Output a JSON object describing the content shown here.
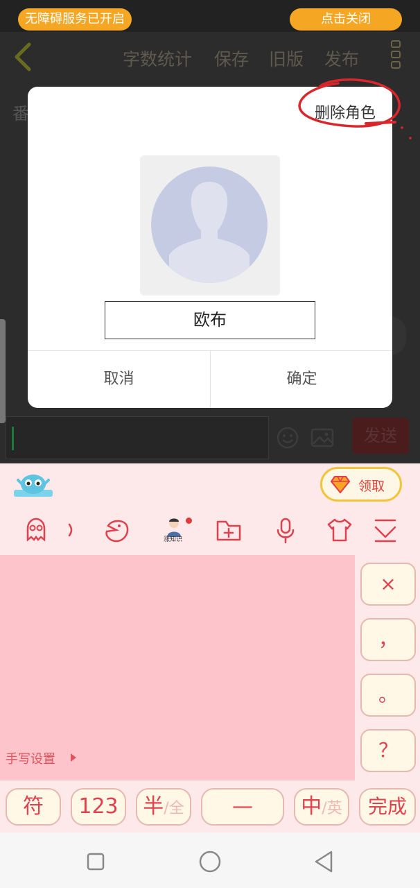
{
  "status_bar": {
    "accessibility_notice": "无障碍服务已开启",
    "close_label": "点击关闭"
  },
  "header": {
    "items": [
      "字数统计",
      "保存",
      "旧版",
      "发布"
    ]
  },
  "background": {
    "partial_text": "番",
    "send_label": "发送"
  },
  "dialog": {
    "delete_role_label": "删除角色",
    "name_value": "欧布",
    "cancel_label": "取消",
    "confirm_label": "确定"
  },
  "keyboard": {
    "reward_label": "领取",
    "tool_caption": "涨知识",
    "handwriting_settings": "手写设置",
    "side_keys": [
      "×",
      "，",
      "。",
      "？"
    ],
    "bottom_keys": {
      "symbols": "符",
      "numbers": "123",
      "half": "半",
      "full": "/全",
      "space": "—",
      "chinese": "中",
      "english": "/英",
      "done": "完成"
    }
  },
  "colors": {
    "accent_orange": "#f5a623",
    "annotation_red": "#d9262b",
    "keyboard_pink": "#fec4cb",
    "key_text_red": "#e0414c"
  }
}
